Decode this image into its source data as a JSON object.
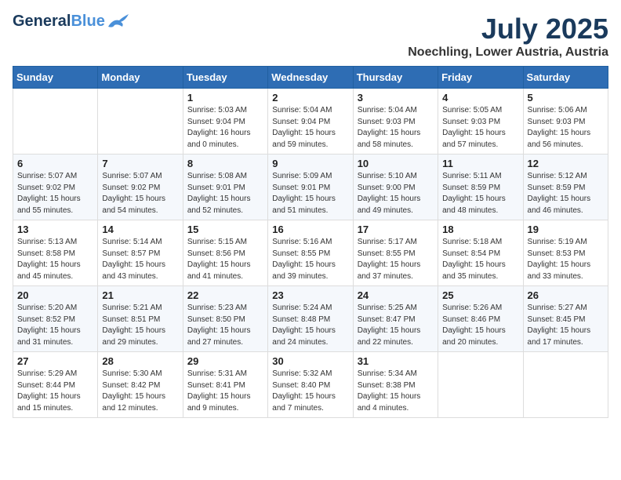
{
  "header": {
    "logo_line1": "General",
    "logo_line2": "Blue",
    "title": "July 2025",
    "subtitle": "Noechling, Lower Austria, Austria"
  },
  "calendar": {
    "weekdays": [
      "Sunday",
      "Monday",
      "Tuesday",
      "Wednesday",
      "Thursday",
      "Friday",
      "Saturday"
    ],
    "weeks": [
      [
        {
          "day": "",
          "info": ""
        },
        {
          "day": "",
          "info": ""
        },
        {
          "day": "1",
          "info": "Sunrise: 5:03 AM\nSunset: 9:04 PM\nDaylight: 16 hours\nand 0 minutes."
        },
        {
          "day": "2",
          "info": "Sunrise: 5:04 AM\nSunset: 9:04 PM\nDaylight: 15 hours\nand 59 minutes."
        },
        {
          "day": "3",
          "info": "Sunrise: 5:04 AM\nSunset: 9:03 PM\nDaylight: 15 hours\nand 58 minutes."
        },
        {
          "day": "4",
          "info": "Sunrise: 5:05 AM\nSunset: 9:03 PM\nDaylight: 15 hours\nand 57 minutes."
        },
        {
          "day": "5",
          "info": "Sunrise: 5:06 AM\nSunset: 9:03 PM\nDaylight: 15 hours\nand 56 minutes."
        }
      ],
      [
        {
          "day": "6",
          "info": "Sunrise: 5:07 AM\nSunset: 9:02 PM\nDaylight: 15 hours\nand 55 minutes."
        },
        {
          "day": "7",
          "info": "Sunrise: 5:07 AM\nSunset: 9:02 PM\nDaylight: 15 hours\nand 54 minutes."
        },
        {
          "day": "8",
          "info": "Sunrise: 5:08 AM\nSunset: 9:01 PM\nDaylight: 15 hours\nand 52 minutes."
        },
        {
          "day": "9",
          "info": "Sunrise: 5:09 AM\nSunset: 9:01 PM\nDaylight: 15 hours\nand 51 minutes."
        },
        {
          "day": "10",
          "info": "Sunrise: 5:10 AM\nSunset: 9:00 PM\nDaylight: 15 hours\nand 49 minutes."
        },
        {
          "day": "11",
          "info": "Sunrise: 5:11 AM\nSunset: 8:59 PM\nDaylight: 15 hours\nand 48 minutes."
        },
        {
          "day": "12",
          "info": "Sunrise: 5:12 AM\nSunset: 8:59 PM\nDaylight: 15 hours\nand 46 minutes."
        }
      ],
      [
        {
          "day": "13",
          "info": "Sunrise: 5:13 AM\nSunset: 8:58 PM\nDaylight: 15 hours\nand 45 minutes."
        },
        {
          "day": "14",
          "info": "Sunrise: 5:14 AM\nSunset: 8:57 PM\nDaylight: 15 hours\nand 43 minutes."
        },
        {
          "day": "15",
          "info": "Sunrise: 5:15 AM\nSunset: 8:56 PM\nDaylight: 15 hours\nand 41 minutes."
        },
        {
          "day": "16",
          "info": "Sunrise: 5:16 AM\nSunset: 8:55 PM\nDaylight: 15 hours\nand 39 minutes."
        },
        {
          "day": "17",
          "info": "Sunrise: 5:17 AM\nSunset: 8:55 PM\nDaylight: 15 hours\nand 37 minutes."
        },
        {
          "day": "18",
          "info": "Sunrise: 5:18 AM\nSunset: 8:54 PM\nDaylight: 15 hours\nand 35 minutes."
        },
        {
          "day": "19",
          "info": "Sunrise: 5:19 AM\nSunset: 8:53 PM\nDaylight: 15 hours\nand 33 minutes."
        }
      ],
      [
        {
          "day": "20",
          "info": "Sunrise: 5:20 AM\nSunset: 8:52 PM\nDaylight: 15 hours\nand 31 minutes."
        },
        {
          "day": "21",
          "info": "Sunrise: 5:21 AM\nSunset: 8:51 PM\nDaylight: 15 hours\nand 29 minutes."
        },
        {
          "day": "22",
          "info": "Sunrise: 5:23 AM\nSunset: 8:50 PM\nDaylight: 15 hours\nand 27 minutes."
        },
        {
          "day": "23",
          "info": "Sunrise: 5:24 AM\nSunset: 8:48 PM\nDaylight: 15 hours\nand 24 minutes."
        },
        {
          "day": "24",
          "info": "Sunrise: 5:25 AM\nSunset: 8:47 PM\nDaylight: 15 hours\nand 22 minutes."
        },
        {
          "day": "25",
          "info": "Sunrise: 5:26 AM\nSunset: 8:46 PM\nDaylight: 15 hours\nand 20 minutes."
        },
        {
          "day": "26",
          "info": "Sunrise: 5:27 AM\nSunset: 8:45 PM\nDaylight: 15 hours\nand 17 minutes."
        }
      ],
      [
        {
          "day": "27",
          "info": "Sunrise: 5:29 AM\nSunset: 8:44 PM\nDaylight: 15 hours\nand 15 minutes."
        },
        {
          "day": "28",
          "info": "Sunrise: 5:30 AM\nSunset: 8:42 PM\nDaylight: 15 hours\nand 12 minutes."
        },
        {
          "day": "29",
          "info": "Sunrise: 5:31 AM\nSunset: 8:41 PM\nDaylight: 15 hours\nand 9 minutes."
        },
        {
          "day": "30",
          "info": "Sunrise: 5:32 AM\nSunset: 8:40 PM\nDaylight: 15 hours\nand 7 minutes."
        },
        {
          "day": "31",
          "info": "Sunrise: 5:34 AM\nSunset: 8:38 PM\nDaylight: 15 hours\nand 4 minutes."
        },
        {
          "day": "",
          "info": ""
        },
        {
          "day": "",
          "info": ""
        }
      ]
    ]
  }
}
